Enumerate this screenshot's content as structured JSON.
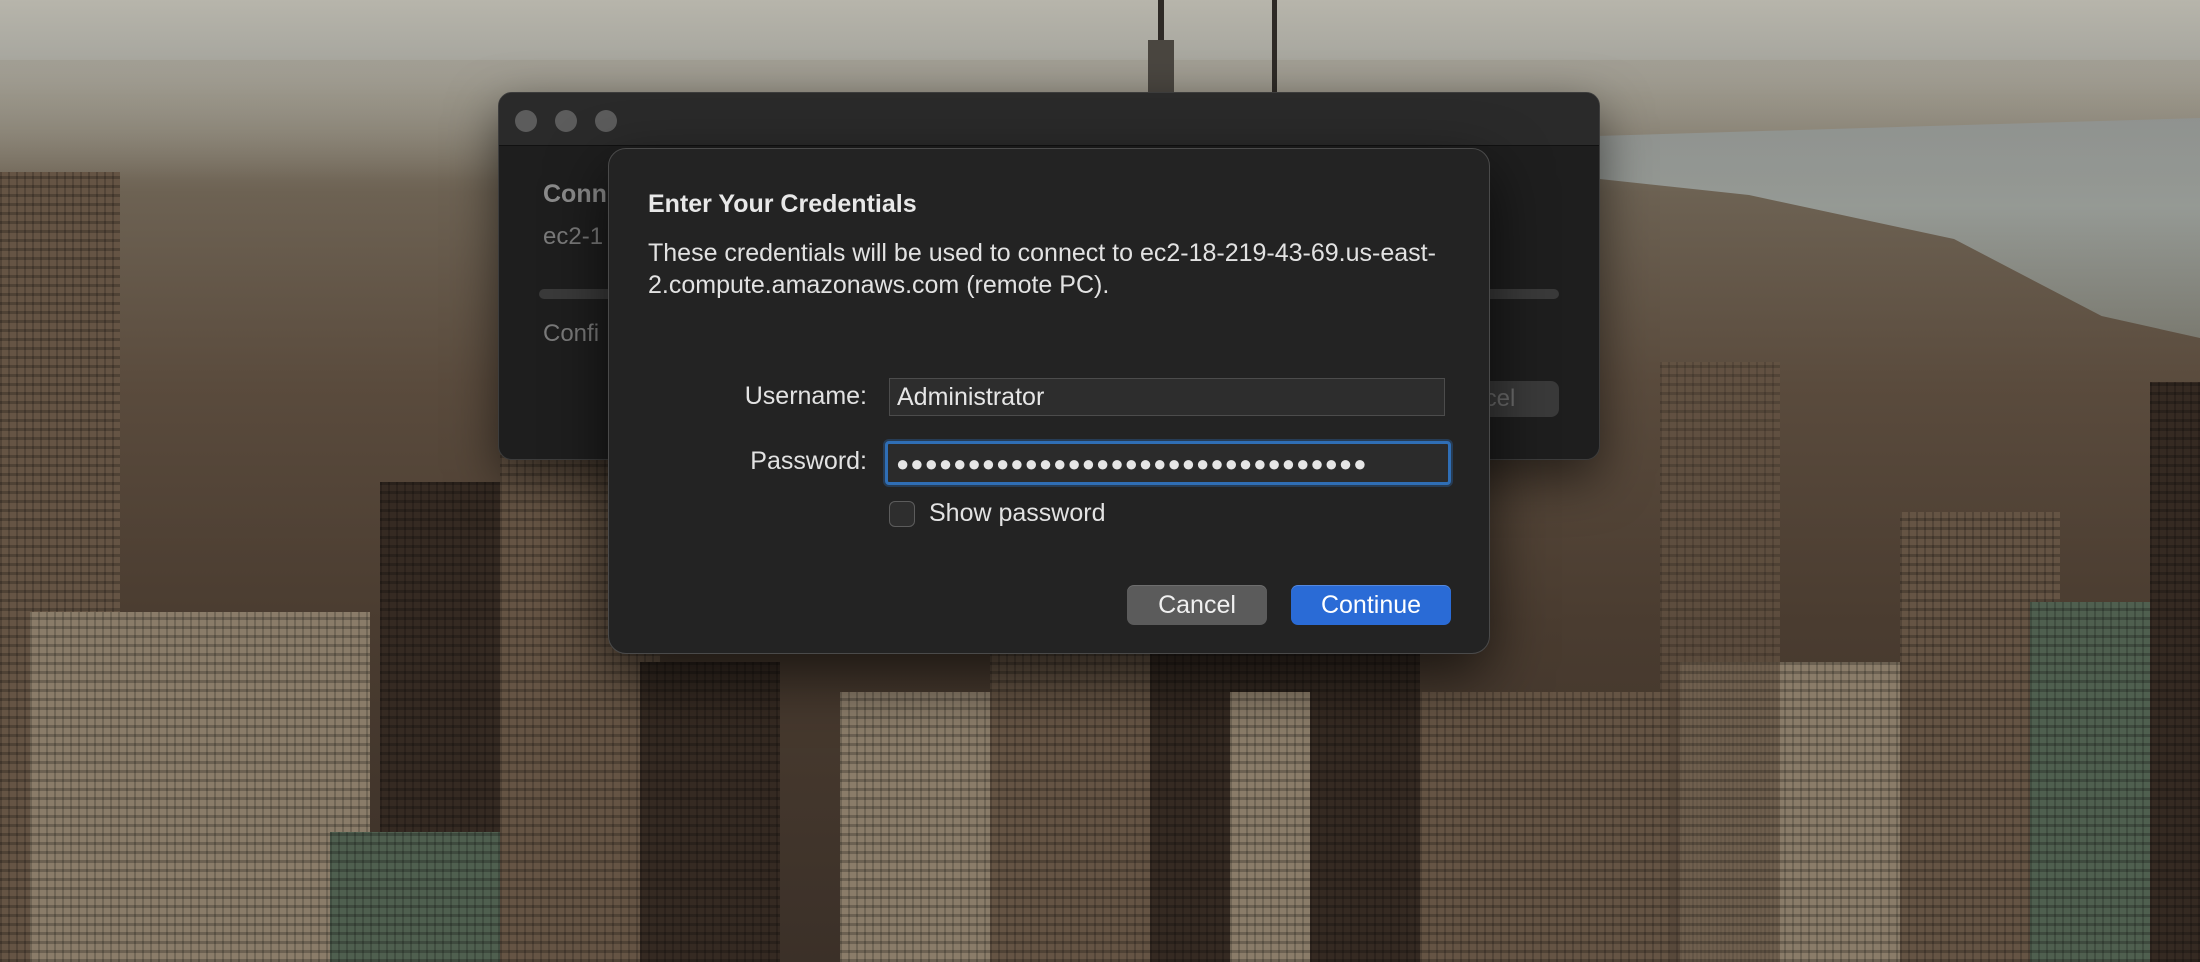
{
  "background_window": {
    "title": "Conn",
    "host": "ec2-1",
    "status": "Confi",
    "cancel_label": "cel"
  },
  "credentials_sheet": {
    "title": "Enter Your Credentials",
    "description": "These credentials will be used to connect to ec2-18-219-43-69.us-east-2.compute.amazonaws.com (remote PC).",
    "username": {
      "label": "Username:",
      "value": "Administrator"
    },
    "password": {
      "label": "Password:",
      "masked_value": "●●●●●●●●●●●●●●●●●●●●●●●●●●●●●●●●●"
    },
    "show_password": {
      "label": "Show password",
      "checked": false
    },
    "buttons": {
      "cancel": "Cancel",
      "continue": "Continue"
    }
  },
  "colors": {
    "accent": "#2a6bd6",
    "focus_ring": "#2f6eb5",
    "sheet_bg": "#232323"
  }
}
